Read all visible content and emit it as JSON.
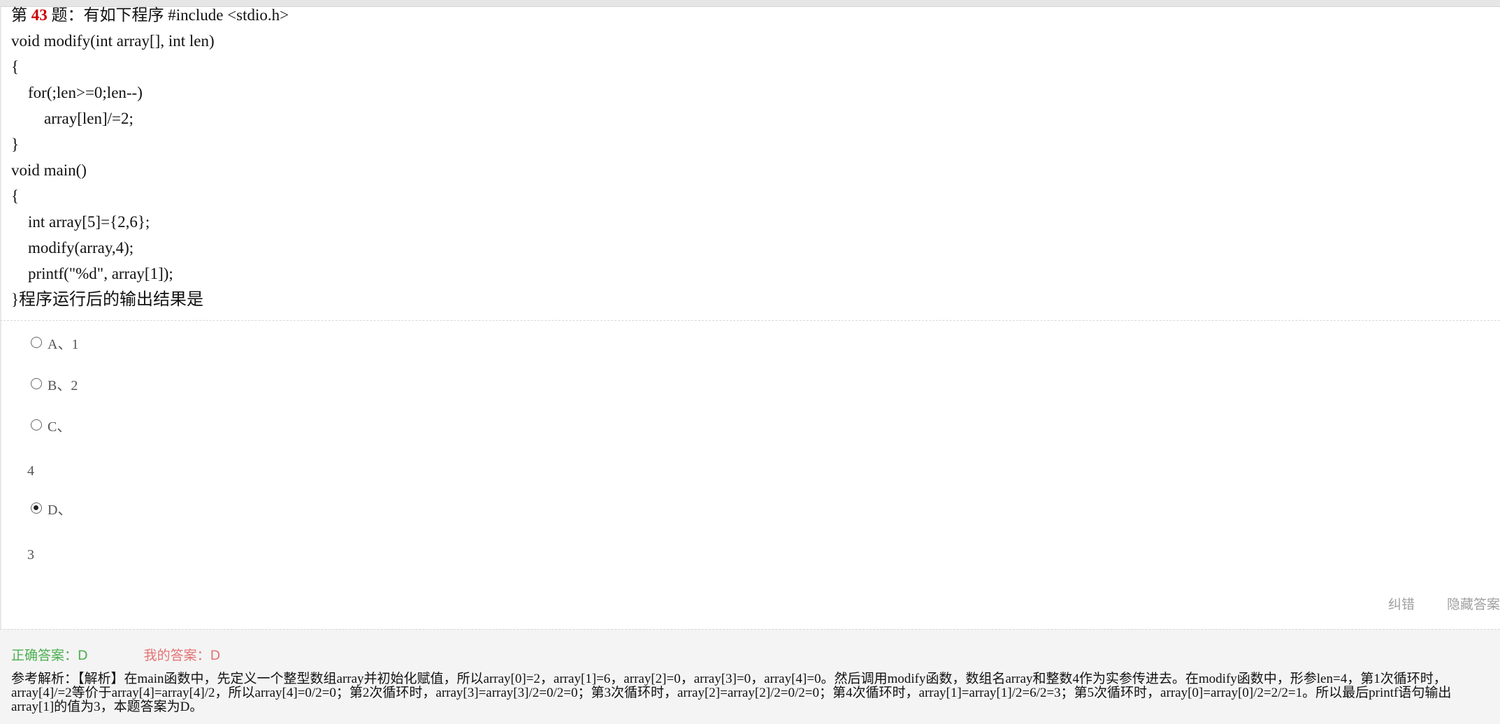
{
  "question": {
    "prefix": "第",
    "number": "43",
    "suffix": "题：有如下程序 #include <stdio.h>",
    "code": [
      {
        "text": "void modify(int array[], int len)",
        "indent": 0
      },
      {
        "text": "{",
        "indent": 0
      },
      {
        "text": "for(;len>=0;len--)",
        "indent": 1
      },
      {
        "text": "array[len]/=2;",
        "indent": 2
      },
      {
        "text": "}",
        "indent": 0
      },
      {
        "text": "void main()",
        "indent": 0
      },
      {
        "text": "{",
        "indent": 0
      },
      {
        "text": "int array[5]={2,6};",
        "indent": 1
      },
      {
        "text": "modify(array,4);",
        "indent": 1
      },
      {
        "text": "printf(\"%d\", array[1]);",
        "indent": 1
      }
    ],
    "closing_brace": "}",
    "stem_tail": "程序运行后的输出结果是"
  },
  "options": [
    {
      "label": "A、1",
      "content": "",
      "selected": false
    },
    {
      "label": "B、2",
      "content": "",
      "selected": false
    },
    {
      "label": "C、",
      "content": "4",
      "selected": false
    },
    {
      "label": "D、",
      "content": "3",
      "selected": true
    }
  ],
  "actions": {
    "report_error": "纠错",
    "hide_answer": "隐藏答案"
  },
  "answers": {
    "correct": "正确答案：D",
    "mine": "我的答案：D"
  },
  "analysis": {
    "label": "参考解析：",
    "text": "【解析】在main函数中，先定义一个整型数组array并初始化赋值，所以array[0]=2，array[1]=6，array[2]=0，array[3]=0，array[4]=0。然后调用modify函数，数组名array和整数4作为实参传进去。在modify函数中，形参len=4，第1次循环时，array[4]/=2等价于array[4]=array[4]/2，所以array[4]=0/2=0；第2次循环时，array[3]=array[3]/2=0/2=0；第3次循环时，array[2]=array[2]/2=0/2=0；第4次循环时，array[1]=array[1]/2=6/2=3；第5次循环时，array[0]=array[0]/2=2/2=1。所以最后printf语句输出array[1]的值为3，本题答案为D。"
  },
  "colors": {
    "question_number": "#cc0000",
    "correct_answer": "#4caf50",
    "my_answer": "#e57373",
    "answer_panel_bg": "#f4f4f4"
  }
}
